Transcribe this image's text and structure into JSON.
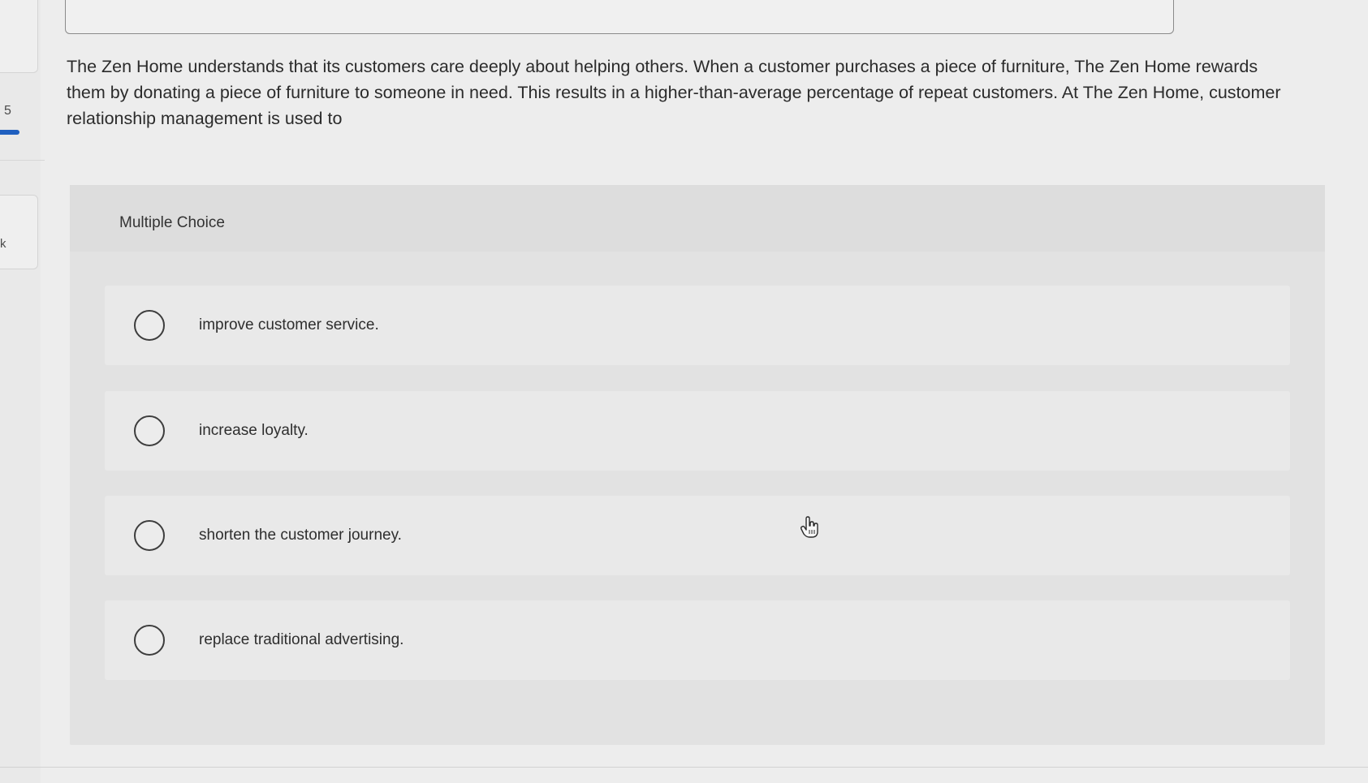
{
  "sidebar": {
    "question_number": "5",
    "partial_label": "k"
  },
  "question": {
    "text": "The Zen Home understands that its customers care deeply about helping others. When a customer purchases a piece of furniture, The Zen Home rewards them by donating a piece of furniture to someone in need. This results in a higher-than-average percentage of repeat customers. At The Zen Home, customer relationship management is used to"
  },
  "multiple_choice": {
    "label": "Multiple Choice",
    "options": [
      {
        "label": "improve customer service."
      },
      {
        "label": "increase loyalty."
      },
      {
        "label": "shorten the customer journey."
      },
      {
        "label": "replace traditional advertising."
      }
    ]
  },
  "colors": {
    "progress_accent": "#1f5fbf",
    "page_background": "#ededed",
    "panel_background": "#e2e2e2"
  },
  "icons": {
    "cursor": "hand-pointer-icon",
    "radio": "radio-circle-icon"
  }
}
